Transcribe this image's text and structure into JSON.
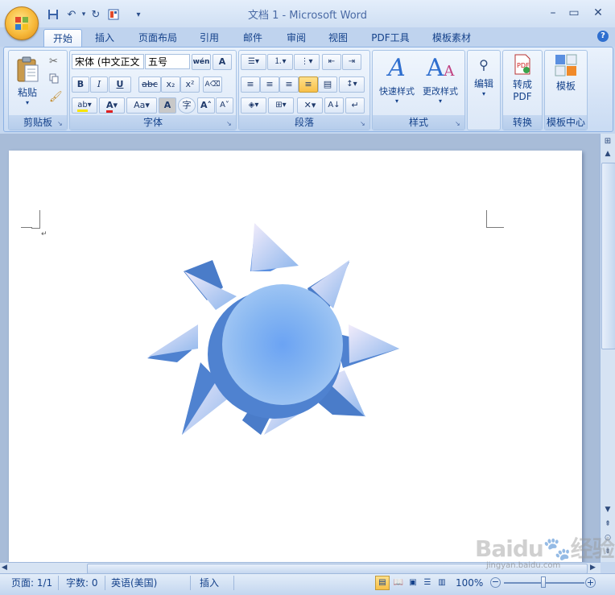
{
  "app": {
    "title": "文档 1 - Microsoft Word"
  },
  "tabs": [
    {
      "label": "开始",
      "active": true
    },
    {
      "label": "插入"
    },
    {
      "label": "页面布局"
    },
    {
      "label": "引用"
    },
    {
      "label": "邮件"
    },
    {
      "label": "审阅"
    },
    {
      "label": "视图"
    },
    {
      "label": "PDF工具"
    },
    {
      "label": "模板素材"
    }
  ],
  "ribbon": {
    "clipboard": {
      "label": "剪贴板",
      "paste": "粘贴"
    },
    "font": {
      "label": "字体",
      "font_name": "宋体 (中文正文",
      "font_size": "五号",
      "wen_glyph": "wén",
      "bold": "B",
      "italic": "I",
      "underline": "U",
      "strike": "abc",
      "subscript": "x₂",
      "superscript": "x²",
      "highlight": "ab",
      "font_color": "A",
      "case": "Aa",
      "char_shading": "A",
      "enclose": "字",
      "grow": "A",
      "shrink": "A"
    },
    "paragraph": {
      "label": "段落"
    },
    "styles": {
      "label": "样式",
      "quick_styles": "快速样式",
      "change_styles": "更改样式"
    },
    "editing": {
      "label": "编辑"
    },
    "convert": {
      "label": "转换",
      "to_pdf_line1": "转成",
      "to_pdf_line2": "PDF"
    },
    "templates": {
      "label": "模板中心",
      "template": "模板"
    }
  },
  "status": {
    "page": "页面: 1/1",
    "words": "字数: 0",
    "language": "英语(美国)",
    "insert_mode": "插入",
    "zoom": "100%"
  },
  "watermark": {
    "brand": "Baidu",
    "cn": "经验",
    "url": "jingyan.baidu.com"
  },
  "colors": {
    "accent": "#15428b",
    "shape_blue": "#5a8fe0",
    "page": "#ffffff"
  }
}
